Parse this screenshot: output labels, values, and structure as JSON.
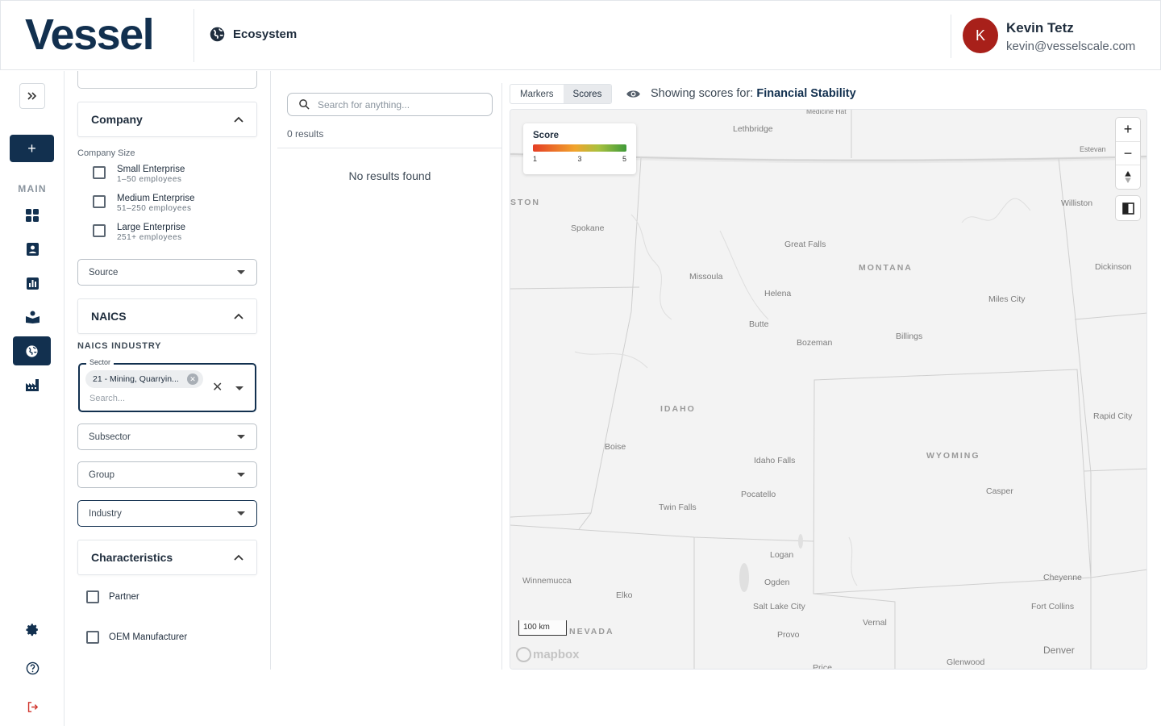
{
  "header": {
    "logo": "Vessel",
    "section": "Ecosystem",
    "user": {
      "initial": "K",
      "name": "Kevin Tetz",
      "email": "kevin@vesselscale.com"
    }
  },
  "nav": {
    "add_label": "+",
    "main_label": "MAIN",
    "icons": [
      "dashboard-icon",
      "contacts-icon",
      "analytics-icon",
      "learning-icon",
      "globe-icon",
      "factory-icon",
      "settings-icon",
      "help-icon",
      "logout-icon"
    ]
  },
  "filters": {
    "company": {
      "title": "Company",
      "size_label": "Company Size",
      "sizes": [
        {
          "label": "Small Enterprise",
          "sub": "1–50 employees"
        },
        {
          "label": "Medium Enterprise",
          "sub": "51–250 employees"
        },
        {
          "label": "Large Enterprise",
          "sub": "251+ employees"
        }
      ],
      "source_placeholder": "Source"
    },
    "naics": {
      "title": "NAICS",
      "industry_label": "NAICS INDUSTRY",
      "sector_legend": "Sector",
      "sector_chip": "21 - Mining, Quarryin...",
      "sector_search_placeholder": "Search...",
      "subsector": "Subsector",
      "group": "Group",
      "industry": "Industry"
    },
    "characteristics": {
      "title": "Characteristics",
      "items": [
        "Partner",
        "OEM Manufacturer"
      ]
    }
  },
  "results": {
    "search_placeholder": "Search for anything...",
    "count": "0 results",
    "empty": "No results found"
  },
  "map": {
    "tabs": [
      "Markers",
      "Scores"
    ],
    "active_tab": "Scores",
    "showing_prefix": "Showing scores for:",
    "showing_value": "Financial Stability",
    "legend": {
      "title": "Score",
      "ticks": [
        "1",
        "3",
        "5"
      ]
    },
    "scale": "100 km",
    "attribution": "mapbox",
    "states": [
      "MONTANA",
      "IDAHO",
      "WYOMING",
      "NEVADA",
      "STON"
    ],
    "cities": [
      "Medicine Hat",
      "Lethbridge",
      "Estevan",
      "Williston",
      "Spokane",
      "Great Falls",
      "Dickinson",
      "Missoula",
      "Helena",
      "Miles City",
      "Butte",
      "Billings",
      "Bozeman",
      "Rapid City",
      "Boise",
      "Idaho Falls",
      "Casper",
      "Pocatello",
      "Twin Falls",
      "Logan",
      "Winnemucca",
      "Ogden",
      "Cheyenne",
      "Elko",
      "Salt Lake City",
      "Fort Collins",
      "Vernal",
      "Provo",
      "Denver",
      "Glenwood",
      "Price"
    ]
  },
  "colors": {
    "brand": "#12304f",
    "avatar": "#a8201a"
  }
}
